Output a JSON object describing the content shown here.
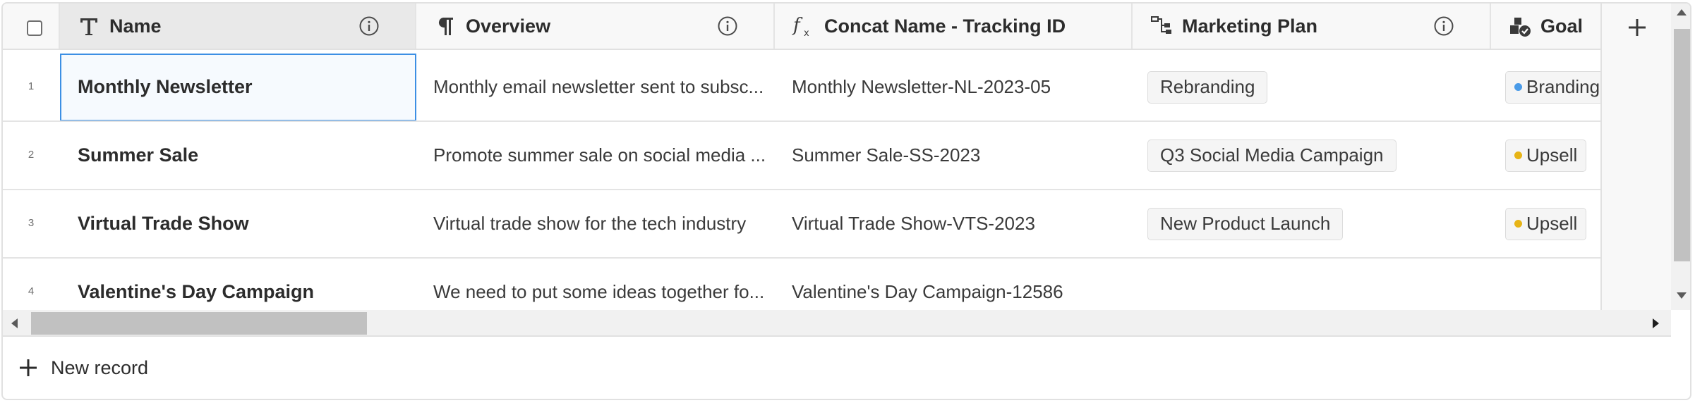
{
  "columns": [
    {
      "title": "Name",
      "icon": "text-type-icon",
      "has_info": true
    },
    {
      "title": "Overview",
      "icon": "paragraph-icon",
      "has_info": true
    },
    {
      "title": "Concat Name - Tracking ID",
      "icon": "formula-icon",
      "has_info": false
    },
    {
      "title": "Marketing Plan",
      "icon": "marketing-plan-icon",
      "has_info": true
    },
    {
      "title": "Goal",
      "icon": "goal-icon",
      "has_info": false
    }
  ],
  "rows": [
    {
      "num": "1",
      "name": "Monthly Newsletter",
      "overview": "Monthly email newsletter sent to subsc...",
      "concat": "Monthly Newsletter-NL-2023-05",
      "marketing_plan": "Rebranding",
      "goal": "Branding",
      "goal_color": "#4a9be8"
    },
    {
      "num": "2",
      "name": "Summer Sale",
      "overview": "Promote summer sale on social media ...",
      "concat": "Summer Sale-SS-2023",
      "marketing_plan": "Q3 Social Media Campaign",
      "goal": "Upsell",
      "goal_color": "#e7b416"
    },
    {
      "num": "3",
      "name": "Virtual Trade Show",
      "overview": "Virtual trade show for the tech industry",
      "concat": "Virtual Trade Show-VTS-2023",
      "marketing_plan": "New Product Launch",
      "goal": "Upsell",
      "goal_color": "#e7b416"
    },
    {
      "num": "4",
      "name": "Valentine's Day Campaign",
      "overview": "We need to put some ideas together fo...",
      "concat": "Valentine's Day Campaign-12586",
      "marketing_plan": "",
      "goal": "",
      "goal_color": ""
    }
  ],
  "footer": {
    "new_record_label": "New record"
  },
  "colors": {
    "selection_border": "#3c8fe4",
    "header_bg": "#f8f8f8",
    "scrollbar_thumb": "#c1c1c1"
  }
}
